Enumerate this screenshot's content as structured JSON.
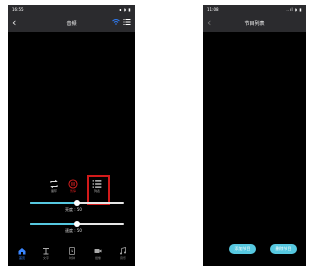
{
  "left_screen": {
    "status_time": "16:55",
    "status_icons": "∎ ◗ ▮",
    "back_glyph": "‹",
    "title": "音频",
    "controls": [
      {
        "label": "循环",
        "icon": "repeat-icon"
      },
      {
        "label": "暂停",
        "icon": "pause-icon"
      },
      {
        "label": "列表",
        "icon": "list-icon"
      }
    ],
    "brightness": {
      "label": "亮度 : 50",
      "value": 50
    },
    "speed": {
      "label": "速度 : 50",
      "value": 50
    },
    "tabs": [
      {
        "label": "首页",
        "icon": "home-icon",
        "active": true
      },
      {
        "label": "文字",
        "icon": "text-icon",
        "active": false
      },
      {
        "label": "时钟",
        "icon": "clock-icon",
        "active": false
      },
      {
        "label": "摄像",
        "icon": "camera-icon",
        "active": false
      },
      {
        "label": "音乐",
        "icon": "music-icon",
        "active": false
      }
    ],
    "colors": {
      "accent_cyan": "#56c8e0",
      "highlight_red": "#d21a1a",
      "active_tab": "#3a86ff"
    }
  },
  "right_screen": {
    "status_time": "11:08",
    "status_icons": "..ıl ◗ ▮",
    "back_glyph": "‹",
    "title": "节目列表",
    "buttons": [
      {
        "label": "添加节目"
      },
      {
        "label": "删除节目"
      }
    ]
  }
}
